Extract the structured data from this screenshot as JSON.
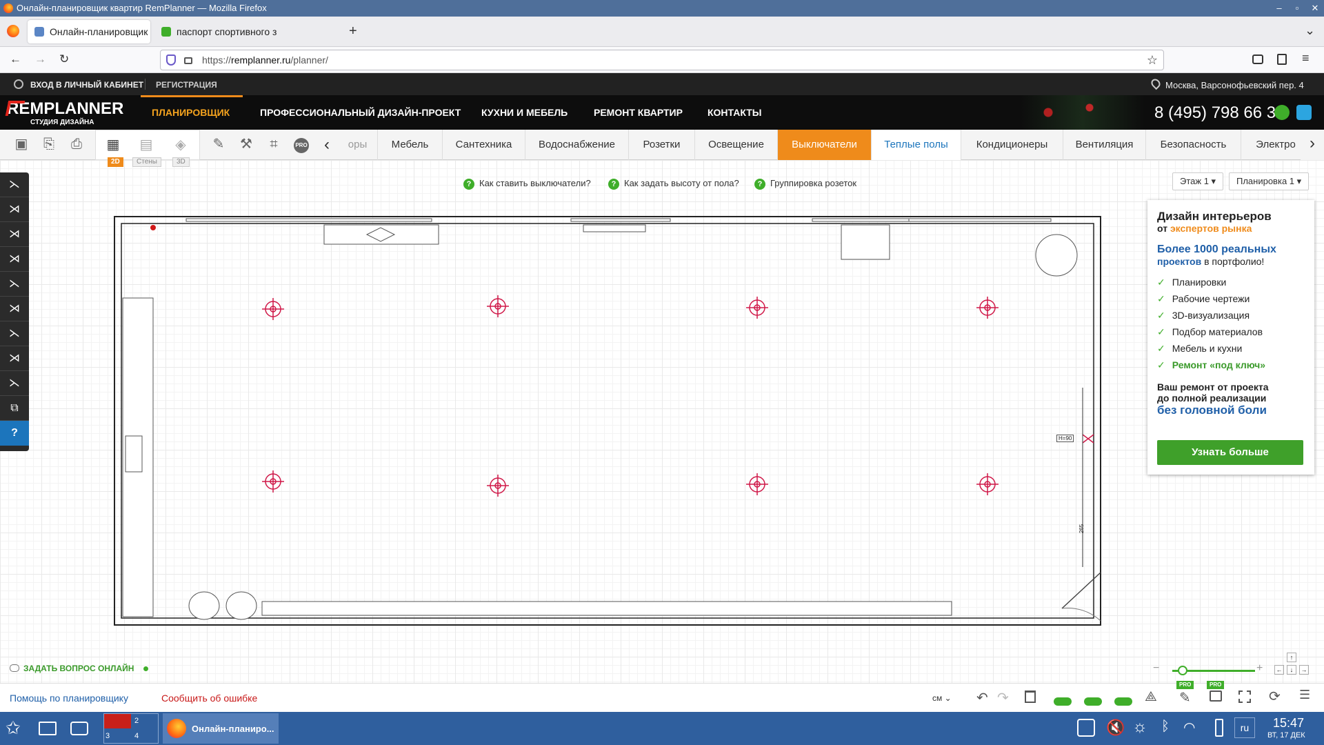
{
  "window": {
    "title": "Онлайн-планировщик квартир RemPlanner — Mozilla Firefox",
    "controls": [
      "–",
      "▫",
      "✕"
    ]
  },
  "tabs": [
    {
      "title": "Онлайн-планировщик кв",
      "close": "✕",
      "favicon_color": "#5b86c5"
    },
    {
      "title": "паспорт спортивного зал",
      "close": "✕",
      "favicon_color": "#3fae2a"
    }
  ],
  "new_tab": "+",
  "tab_list": "⌄",
  "nav": {
    "back": "←",
    "forward": "→",
    "reload": "↻",
    "url_prefix": "https://",
    "url_host": "remplanner.ru",
    "url_path": "/planner/",
    "star": "☆"
  },
  "site": {
    "login": "ВХОД В ЛИЧНЫЙ КАБИНЕТ",
    "register": "РЕГИСТРАЦИЯ",
    "address": "Москва, Варсонофьевский пер. 4",
    "logo_main": "REMPLANNER",
    "logo_sub": "СТУДИЯ ДИЗАЙНА",
    "menu": [
      "ПЛАНИРОВЩИК",
      "ПРОФЕССИОНАЛЬНЫЙ ДИЗАЙН-ПРОЕКТ",
      "КУХНИ И МЕБЕЛЬ",
      "РЕМОНТ КВАРТИР",
      "КОНТАКТЫ"
    ],
    "phone": "8 (495) 798 66 31",
    "accent": "#ef8b1b"
  },
  "toolbar": {
    "view_labels": {
      "v2d": "2D",
      "walls": "Стены",
      "v3d": "3D"
    },
    "pro": "PRO",
    "categories": [
      "оры",
      "Мебель",
      "Сантехника",
      "Водоснабжение",
      "Розетки",
      "Освещение",
      "Выключатели",
      "Теплые полы",
      "Кондиционеры",
      "Вентиляция",
      "Безопасность",
      "Электро"
    ],
    "active_category": "Выключатели",
    "prev": "‹",
    "next": "›"
  },
  "help_links": [
    "Как ставить выключатели?",
    "Как задать высоту от пола?",
    "Группировка розеток"
  ],
  "floor_select": "Этаж 1",
  "plan_select": "Планировка 1",
  "plan_labels": {
    "height_tag": "H=90",
    "dimension": "265"
  },
  "ad": {
    "title1": "Дизайн интерьеров",
    "title2_pre": "от ",
    "title2_hl": "экспертов рынка",
    "sub1": "Более 1000 реальных",
    "sub2_hl": "проектов",
    "sub2_rest": " в портфолио!",
    "items": [
      "Планировки",
      "Рабочие чертежи",
      "3D-визуализация",
      "Подбор материалов",
      "Мебель и кухни",
      "Ремонт «под ключ»"
    ],
    "bottom1": "Ваш ремонт от проекта",
    "bottom2": "до полной реализации",
    "bottom3": "без головной боли",
    "button": "Узнать больше"
  },
  "chat": "ЗАДАТЬ ВОПРОС ОНЛАЙН",
  "bottom": {
    "help": "Помощь по планировщику",
    "report": "Сообщить об ошибке",
    "units": "см",
    "pro1": "PRO",
    "pro2": "PRO"
  },
  "zoom": {
    "minus": "−",
    "plus": "+"
  },
  "taskbar": {
    "window": "Онлайн-планиро...",
    "desks": [
      "1",
      "2",
      "3",
      "4"
    ],
    "lang": "ru",
    "time": "15:47",
    "date": "ВТ, 17 ДЕК"
  }
}
